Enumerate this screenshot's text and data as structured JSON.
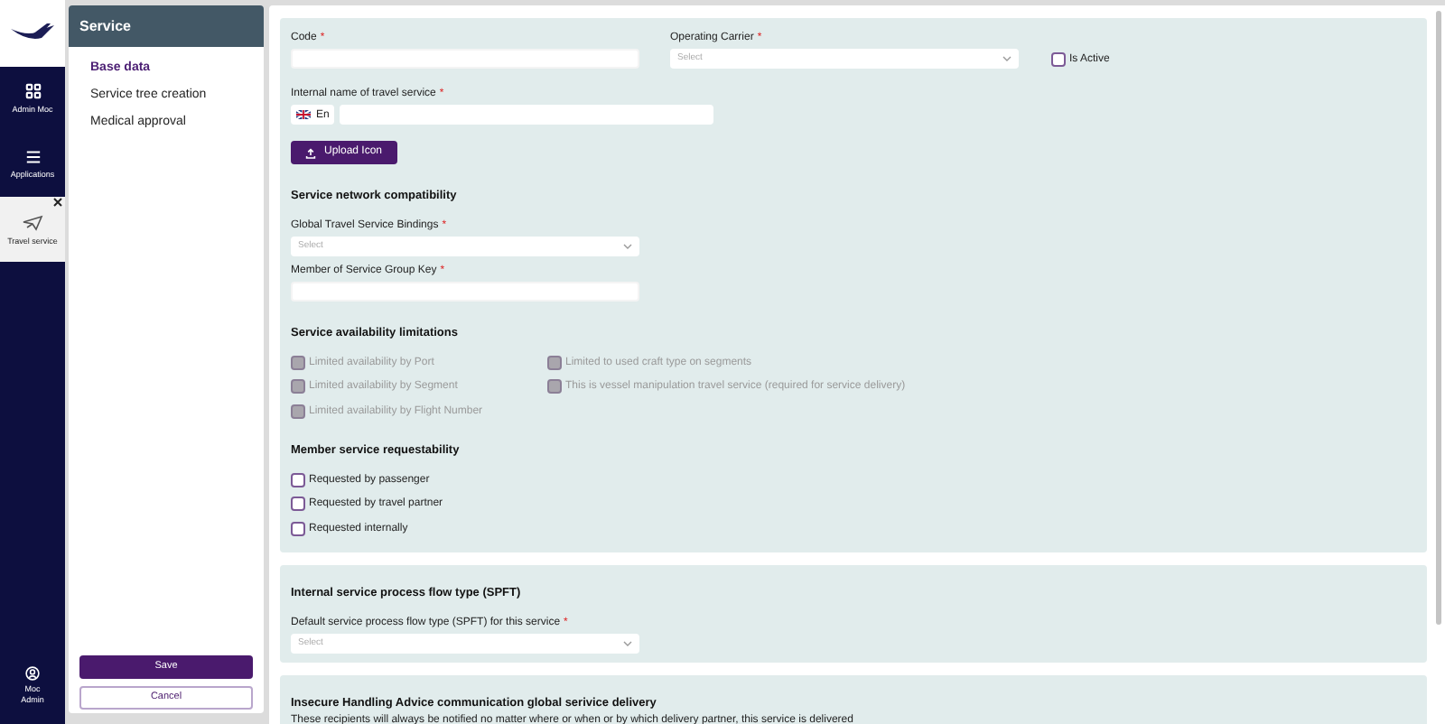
{
  "nav": {
    "items": [
      {
        "label": "Admin Moc",
        "kind": "grid",
        "selected": false,
        "closable": false
      },
      {
        "label": "Applications",
        "kind": "menu",
        "selected": false,
        "closable": false
      },
      {
        "label": "Travel service",
        "kind": "plane",
        "selected": true,
        "closable": true
      }
    ],
    "user": {
      "label": "Moc Admin"
    }
  },
  "sidebar": {
    "title": "Service",
    "items": [
      {
        "label": "Base data",
        "selected": true
      },
      {
        "label": "Service tree creation",
        "selected": false
      },
      {
        "label": "Medical approval",
        "selected": false
      }
    ],
    "buttons": [
      {
        "label": "Save",
        "kind": "primary"
      },
      {
        "label": "Cancel",
        "kind": "secondary"
      }
    ]
  },
  "cards": [
    {
      "blocks": [
        {
          "kind": "field-row",
          "fields": [
            {
              "kind": "text",
              "label": "Code",
              "required_mark": "*"
            },
            {
              "kind": "select",
              "label": "Operating Carrier",
              "required_mark": "*",
              "placeholder": "Select"
            },
            {
              "kind": "checkbox",
              "label": "Is Active",
              "checked": false
            }
          ]
        },
        {
          "kind": "field-row",
          "fields": [
            {
              "kind": "lang-text",
              "label": "Internal name of travel service",
              "required_mark": "*",
              "language": "En"
            }
          ]
        },
        {
          "kind": "button",
          "label": "Upload Icon"
        },
        {
          "kind": "heading",
          "text": "Service network compatibility"
        },
        {
          "kind": "field-row",
          "fields": [
            {
              "kind": "select",
              "label": "Global Travel Service Bindings",
              "required_mark": "*",
              "placeholder": "Select"
            }
          ]
        },
        {
          "kind": "field-row",
          "fields": [
            {
              "kind": "text",
              "label": "Member of Service Group Key",
              "required_mark": "*"
            }
          ]
        },
        {
          "kind": "heading",
          "text": "Service availability limitations"
        },
        {
          "kind": "checkbox-grid",
          "columns": [
            [
              {
                "label": "Limited availability by Port",
                "checked": false,
                "disabled": true
              },
              {
                "label": "Limited availability by Segment",
                "checked": false,
                "disabled": true
              },
              {
                "label": "Limited availability by Flight Number",
                "checked": false,
                "disabled": true
              }
            ],
            [
              {
                "label": "Limited to used craft type on segments",
                "checked": false,
                "disabled": true
              },
              {
                "label": "This is vessel manipulation travel service (required for service delivery)",
                "checked": false,
                "disabled": true
              }
            ]
          ]
        },
        {
          "kind": "heading",
          "text": "Member service requestability"
        },
        {
          "kind": "checkbox-grid",
          "columns": [
            [
              {
                "label": "Requested by passenger",
                "checked": false,
                "disabled": false
              },
              {
                "label": "Requested by travel partner",
                "checked": false,
                "disabled": false
              },
              {
                "label": "Requested internally",
                "checked": false,
                "disabled": false
              }
            ]
          ]
        }
      ]
    },
    {
      "blocks": [
        {
          "kind": "heading",
          "text": "Internal service process flow type (SPFT)"
        },
        {
          "kind": "field-row",
          "fields": [
            {
              "kind": "select",
              "label": "Default service process flow type (SPFT) for this service",
              "required_mark": "*",
              "placeholder": "Select"
            }
          ]
        }
      ]
    },
    {
      "blocks": [
        {
          "kind": "heading",
          "text": "Insecure Handling Advice communication global serivice delivery"
        },
        {
          "kind": "text",
          "text": "These recipients will always be notified no matter where or when or by which delivery partner, this service is delivered"
        }
      ]
    }
  ]
}
